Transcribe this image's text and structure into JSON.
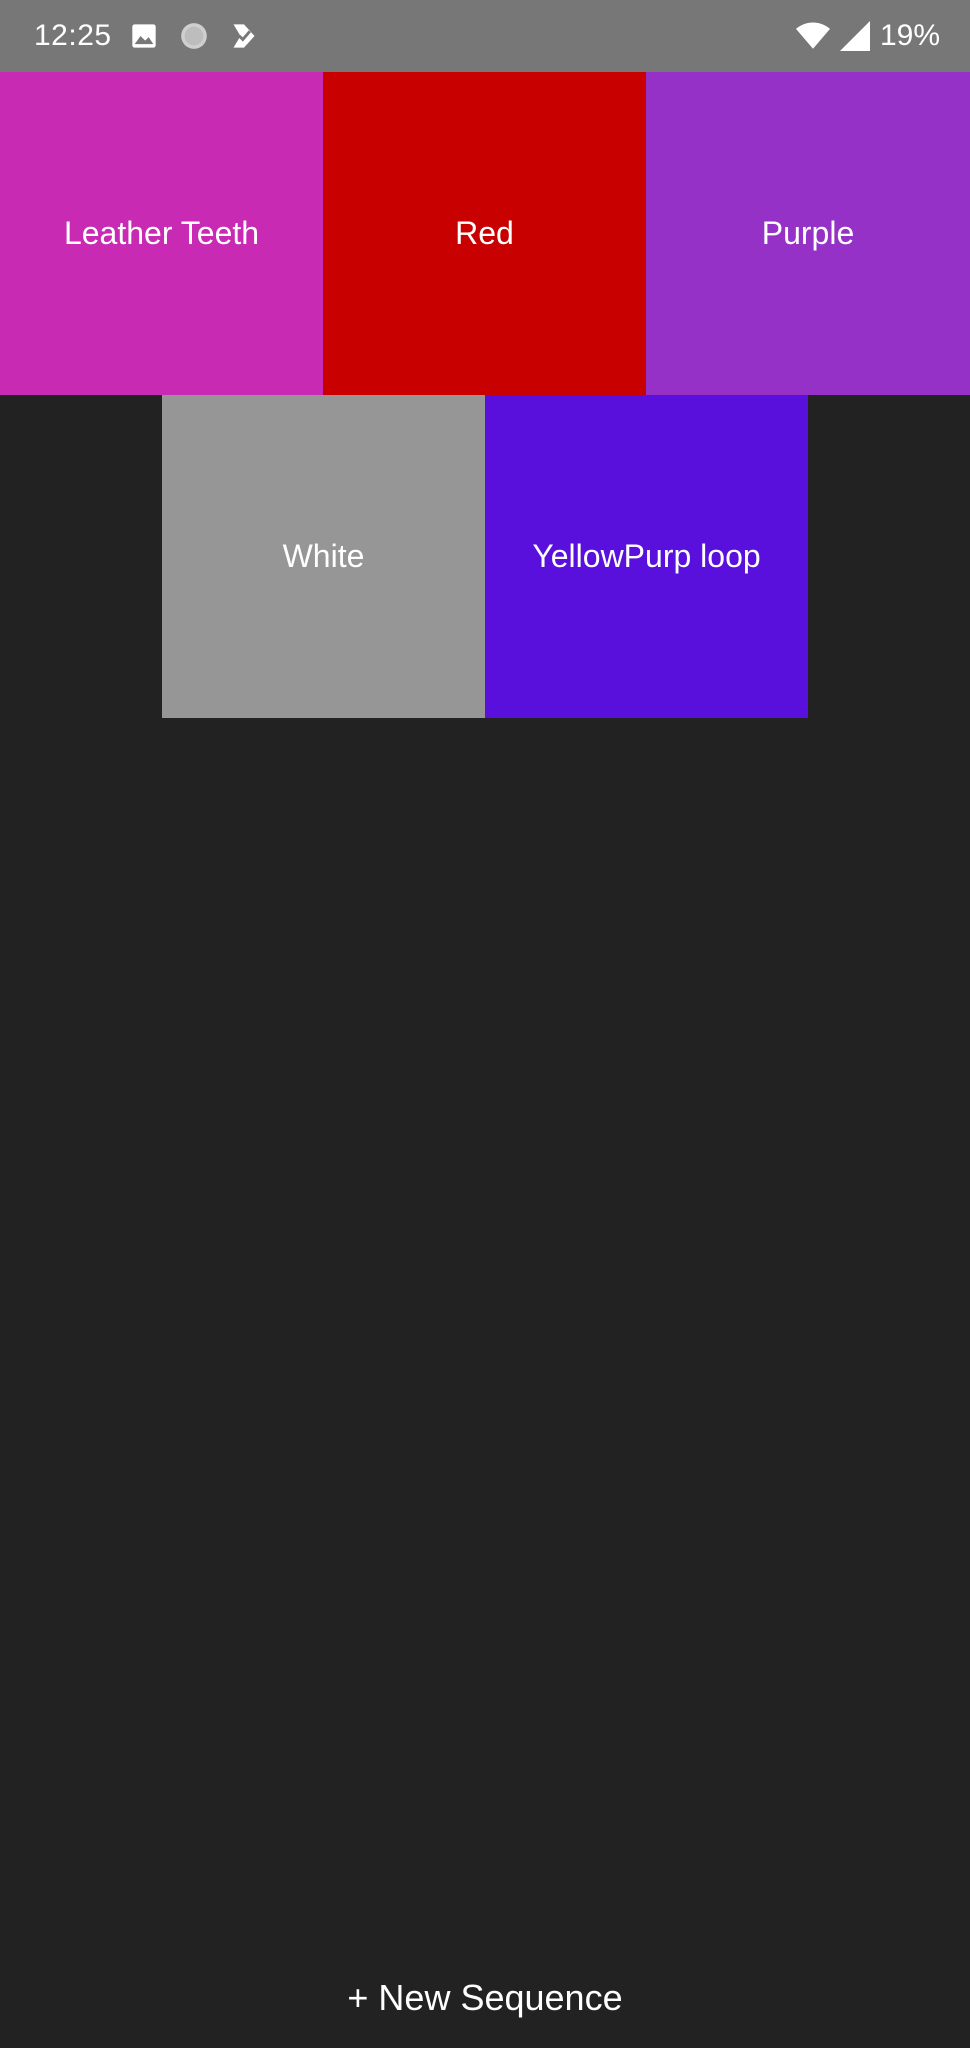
{
  "status_bar": {
    "time": "12:25",
    "battery_text": "19%",
    "icons": [
      "image-icon",
      "circle-notification-icon",
      "checkmark-app-icon",
      "wifi-icon",
      "cell-signal-icon"
    ]
  },
  "tiles": [
    {
      "label": "Leather Teeth",
      "color": "#C82AB4"
    },
    {
      "label": "Red",
      "color": "#C80000"
    },
    {
      "label": "Purple",
      "color": "#9631C8"
    },
    {
      "label": "White",
      "color": "#969696"
    },
    {
      "label": "YellowPurp loop",
      "color": "#5A10DC"
    }
  ],
  "new_sequence_button": {
    "label": "+ New Sequence"
  },
  "colors": {
    "background": "#222222",
    "status_bar": "#777777"
  }
}
